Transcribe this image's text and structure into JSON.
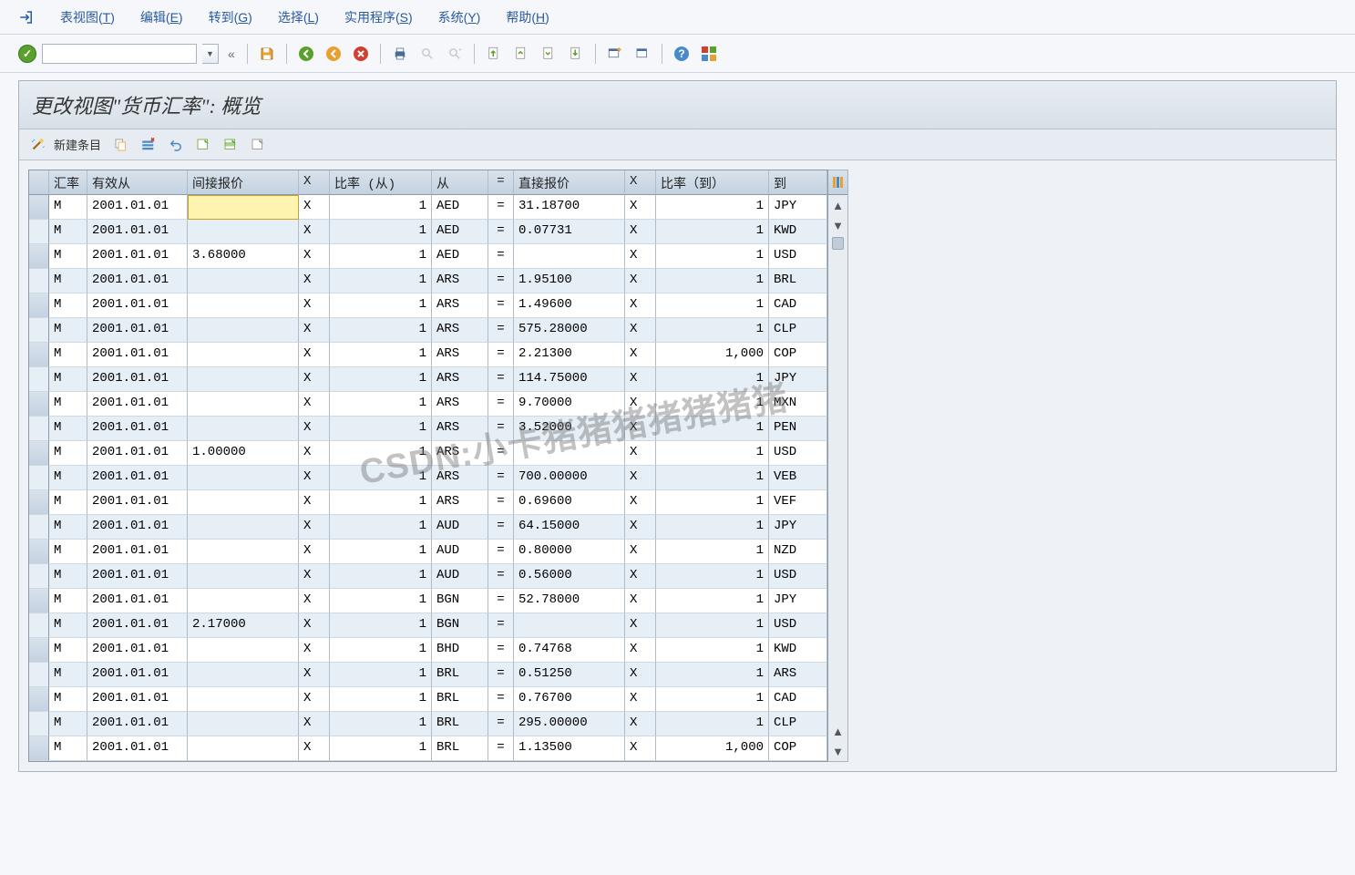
{
  "menu": {
    "items": [
      {
        "label": "表视图",
        "key": "T"
      },
      {
        "label": "编辑",
        "key": "E"
      },
      {
        "label": "转到",
        "key": "G"
      },
      {
        "label": "选择",
        "key": "L"
      },
      {
        "label": "实用程序",
        "key": "S"
      },
      {
        "label": "系统",
        "key": "Y"
      },
      {
        "label": "帮助",
        "key": "H"
      }
    ]
  },
  "toolbar": {
    "cmd_value": "",
    "icons": [
      "save",
      "back",
      "exit",
      "cancel",
      "print",
      "find",
      "find-next",
      "first",
      "prev",
      "next",
      "last",
      "new-session",
      "shortcut",
      "help",
      "layout"
    ]
  },
  "page": {
    "title": "更改视图\"货币汇率\": 概览"
  },
  "subtoolbar": {
    "new_entry_label": "新建条目",
    "icons": [
      "wizard",
      "copy",
      "delete",
      "undo",
      "select-all",
      "select-block",
      "deselect"
    ]
  },
  "columns": {
    "sel": "",
    "type": "汇率",
    "date": "有效从",
    "indirect": "间接报价",
    "x1": "X",
    "ratio_from": "比率 (从)",
    "from": "从",
    "eq": "=",
    "direct": "直接报价",
    "x2": "X",
    "ratio_to": "比率（到）",
    "to": "到"
  },
  "rows": [
    {
      "type": "M",
      "date": "2001.01.01",
      "indirect": "",
      "x1": "X",
      "ratio_from": "1",
      "from": "AED",
      "eq": "=",
      "direct": "31.18700",
      "x2": "X",
      "ratio_to": "1",
      "to": "JPY",
      "editing": true
    },
    {
      "type": "M",
      "date": "2001.01.01",
      "indirect": "",
      "x1": "X",
      "ratio_from": "1",
      "from": "AED",
      "eq": "=",
      "direct": "0.07731",
      "x2": "X",
      "ratio_to": "1",
      "to": "KWD"
    },
    {
      "type": "M",
      "date": "2001.01.01",
      "indirect": "3.68000",
      "x1": "X",
      "ratio_from": "1",
      "from": "AED",
      "eq": "=",
      "direct": "",
      "x2": "X",
      "ratio_to": "1",
      "to": "USD"
    },
    {
      "type": "M",
      "date": "2001.01.01",
      "indirect": "",
      "x1": "X",
      "ratio_from": "1",
      "from": "ARS",
      "eq": "=",
      "direct": "1.95100",
      "x2": "X",
      "ratio_to": "1",
      "to": "BRL"
    },
    {
      "type": "M",
      "date": "2001.01.01",
      "indirect": "",
      "x1": "X",
      "ratio_from": "1",
      "from": "ARS",
      "eq": "=",
      "direct": "1.49600",
      "x2": "X",
      "ratio_to": "1",
      "to": "CAD"
    },
    {
      "type": "M",
      "date": "2001.01.01",
      "indirect": "",
      "x1": "X",
      "ratio_from": "1",
      "from": "ARS",
      "eq": "=",
      "direct": "575.28000",
      "x2": "X",
      "ratio_to": "1",
      "to": "CLP"
    },
    {
      "type": "M",
      "date": "2001.01.01",
      "indirect": "",
      "x1": "X",
      "ratio_from": "1",
      "from": "ARS",
      "eq": "=",
      "direct": "2.21300",
      "x2": "X",
      "ratio_to": "1,000",
      "to": "COP"
    },
    {
      "type": "M",
      "date": "2001.01.01",
      "indirect": "",
      "x1": "X",
      "ratio_from": "1",
      "from": "ARS",
      "eq": "=",
      "direct": "114.75000",
      "x2": "X",
      "ratio_to": "1",
      "to": "JPY"
    },
    {
      "type": "M",
      "date": "2001.01.01",
      "indirect": "",
      "x1": "X",
      "ratio_from": "1",
      "from": "ARS",
      "eq": "=",
      "direct": "9.70000",
      "x2": "X",
      "ratio_to": "1",
      "to": "MXN"
    },
    {
      "type": "M",
      "date": "2001.01.01",
      "indirect": "",
      "x1": "X",
      "ratio_from": "1",
      "from": "ARS",
      "eq": "=",
      "direct": "3.52000",
      "x2": "X",
      "ratio_to": "1",
      "to": "PEN"
    },
    {
      "type": "M",
      "date": "2001.01.01",
      "indirect": "1.00000",
      "x1": "X",
      "ratio_from": "1",
      "from": "ARS",
      "eq": "=",
      "direct": "",
      "x2": "X",
      "ratio_to": "1",
      "to": "USD"
    },
    {
      "type": "M",
      "date": "2001.01.01",
      "indirect": "",
      "x1": "X",
      "ratio_from": "1",
      "from": "ARS",
      "eq": "=",
      "direct": "700.00000",
      "x2": "X",
      "ratio_to": "1",
      "to": "VEB"
    },
    {
      "type": "M",
      "date": "2001.01.01",
      "indirect": "",
      "x1": "X",
      "ratio_from": "1",
      "from": "ARS",
      "eq": "=",
      "direct": "0.69600",
      "x2": "X",
      "ratio_to": "1",
      "to": "VEF"
    },
    {
      "type": "M",
      "date": "2001.01.01",
      "indirect": "",
      "x1": "X",
      "ratio_from": "1",
      "from": "AUD",
      "eq": "=",
      "direct": "64.15000",
      "x2": "X",
      "ratio_to": "1",
      "to": "JPY"
    },
    {
      "type": "M",
      "date": "2001.01.01",
      "indirect": "",
      "x1": "X",
      "ratio_from": "1",
      "from": "AUD",
      "eq": "=",
      "direct": "0.80000",
      "x2": "X",
      "ratio_to": "1",
      "to": "NZD"
    },
    {
      "type": "M",
      "date": "2001.01.01",
      "indirect": "",
      "x1": "X",
      "ratio_from": "1",
      "from": "AUD",
      "eq": "=",
      "direct": "0.56000",
      "x2": "X",
      "ratio_to": "1",
      "to": "USD"
    },
    {
      "type": "M",
      "date": "2001.01.01",
      "indirect": "",
      "x1": "X",
      "ratio_from": "1",
      "from": "BGN",
      "eq": "=",
      "direct": "52.78000",
      "x2": "X",
      "ratio_to": "1",
      "to": "JPY"
    },
    {
      "type": "M",
      "date": "2001.01.01",
      "indirect": "2.17000",
      "x1": "X",
      "ratio_from": "1",
      "from": "BGN",
      "eq": "=",
      "direct": "",
      "x2": "X",
      "ratio_to": "1",
      "to": "USD"
    },
    {
      "type": "M",
      "date": "2001.01.01",
      "indirect": "",
      "x1": "X",
      "ratio_from": "1",
      "from": "BHD",
      "eq": "=",
      "direct": "0.74768",
      "x2": "X",
      "ratio_to": "1",
      "to": "KWD"
    },
    {
      "type": "M",
      "date": "2001.01.01",
      "indirect": "",
      "x1": "X",
      "ratio_from": "1",
      "from": "BRL",
      "eq": "=",
      "direct": "0.51250",
      "x2": "X",
      "ratio_to": "1",
      "to": "ARS"
    },
    {
      "type": "M",
      "date": "2001.01.01",
      "indirect": "",
      "x1": "X",
      "ratio_from": "1",
      "from": "BRL",
      "eq": "=",
      "direct": "0.76700",
      "x2": "X",
      "ratio_to": "1",
      "to": "CAD"
    },
    {
      "type": "M",
      "date": "2001.01.01",
      "indirect": "",
      "x1": "X",
      "ratio_from": "1",
      "from": "BRL",
      "eq": "=",
      "direct": "295.00000",
      "x2": "X",
      "ratio_to": "1",
      "to": "CLP"
    },
    {
      "type": "M",
      "date": "2001.01.01",
      "indirect": "",
      "x1": "X",
      "ratio_from": "1",
      "from": "BRL",
      "eq": "=",
      "direct": "1.13500",
      "x2": "X",
      "ratio_to": "1,000",
      "to": "COP"
    }
  ],
  "watermark": "CSDN:小卡猪猪猪猪猪猪猪"
}
